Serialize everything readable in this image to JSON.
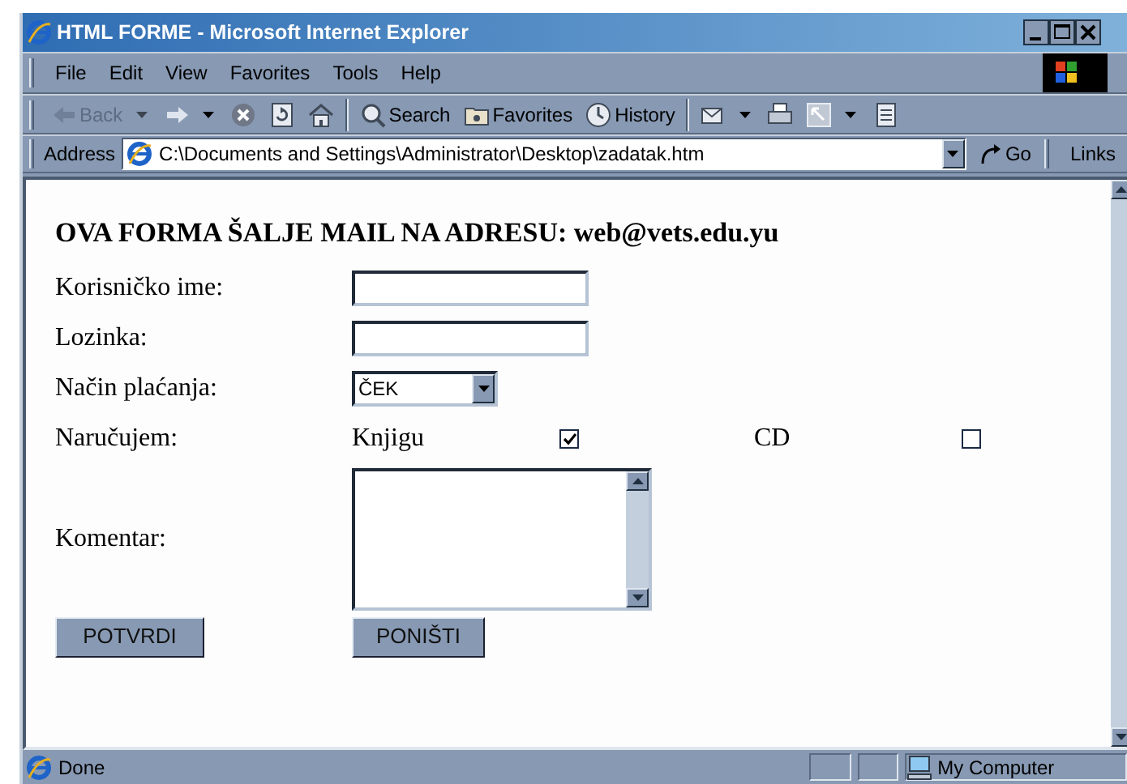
{
  "window": {
    "title": "HTML FORME - Microsoft Internet Explorer"
  },
  "menu": [
    {
      "label": "File"
    },
    {
      "label": "Edit"
    },
    {
      "label": "View"
    },
    {
      "label": "Favorites"
    },
    {
      "label": "Tools"
    },
    {
      "label": "Help"
    }
  ],
  "toolbar": [
    {
      "label": "Back",
      "disabled": true,
      "dropdown": true
    },
    {
      "disabled": false,
      "dropdown": true
    },
    {
      "disabled": false,
      "dropdown": false
    },
    {
      "disabled": false,
      "dropdown": false
    },
    {
      "disabled": false,
      "dropdown": false
    },
    {
      "label": "Search",
      "disabled": false,
      "dropdown": false
    },
    {
      "label": "Favorites",
      "disabled": false,
      "dropdown": false
    },
    {
      "label": "History",
      "disabled": false,
      "dropdown": false
    },
    {
      "disabled": false,
      "dropdown": true
    },
    {
      "disabled": false,
      "dropdown": false
    },
    {
      "disabled": false,
      "dropdown": true
    },
    {
      "disabled": false,
      "dropdown": false
    }
  ],
  "address": {
    "label": "Address",
    "value": "C:\\Documents and Settings\\Administrator\\Desktop\\zadatak.htm",
    "go": "Go",
    "links": "Links"
  },
  "page": {
    "heading": "OVA FORMA ŠALJE MAIL NA ADRESU: web@vets.edu.yu",
    "rows": [
      {
        "kind": "text",
        "label": "Korisničko ime:"
      },
      {
        "kind": "password",
        "label": "Lozinka:"
      },
      {
        "kind": "select",
        "label": "Način plaćanja:",
        "value": "ČEK"
      },
      {
        "kind": "choices",
        "label": "Naručujem:",
        "options": [
          {
            "label": "Knjigu",
            "checked": true
          },
          {
            "label": "CD",
            "checked": false
          }
        ]
      },
      {
        "kind": "textarea",
        "label": "Komentar:"
      }
    ],
    "buttons": [
      {
        "label": "POTVRDI"
      },
      {
        "label": "PONIŠTI"
      }
    ]
  },
  "status_bar": {
    "text": "Done",
    "zone": "My Computer"
  }
}
